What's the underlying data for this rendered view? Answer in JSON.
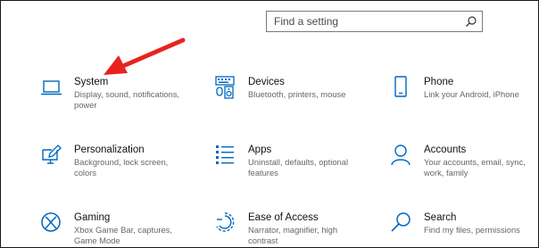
{
  "search": {
    "placeholder": "Find a setting",
    "icon": "search-icon"
  },
  "accent_color": "#0067c0",
  "arrow_color": "#e8231f",
  "tiles": [
    {
      "id": "system",
      "title": "System",
      "desc": "Display, sound, notifications, power",
      "icon": "laptop-icon"
    },
    {
      "id": "devices",
      "title": "Devices",
      "desc": "Bluetooth, printers, mouse",
      "icon": "keyboard-speaker-icon"
    },
    {
      "id": "phone",
      "title": "Phone",
      "desc": "Link your Android, iPhone",
      "icon": "phone-icon"
    },
    {
      "id": "personalization",
      "title": "Personalization",
      "desc": "Background, lock screen, colors",
      "icon": "paint-monitor-icon"
    },
    {
      "id": "apps",
      "title": "Apps",
      "desc": "Uninstall, defaults, optional features",
      "icon": "apps-list-icon"
    },
    {
      "id": "accounts",
      "title": "Accounts",
      "desc": "Your accounts, email, sync, work, family",
      "icon": "person-icon"
    },
    {
      "id": "gaming",
      "title": "Gaming",
      "desc": "Xbox Game Bar, captures, Game Mode",
      "icon": "xbox-icon"
    },
    {
      "id": "ease",
      "title": "Ease of Access",
      "desc": "Narrator, magnifier, high contrast",
      "icon": "ease-of-access-icon"
    },
    {
      "id": "search",
      "title": "Search",
      "desc": "Find my files, permissions",
      "icon": "magnifier-icon"
    }
  ]
}
